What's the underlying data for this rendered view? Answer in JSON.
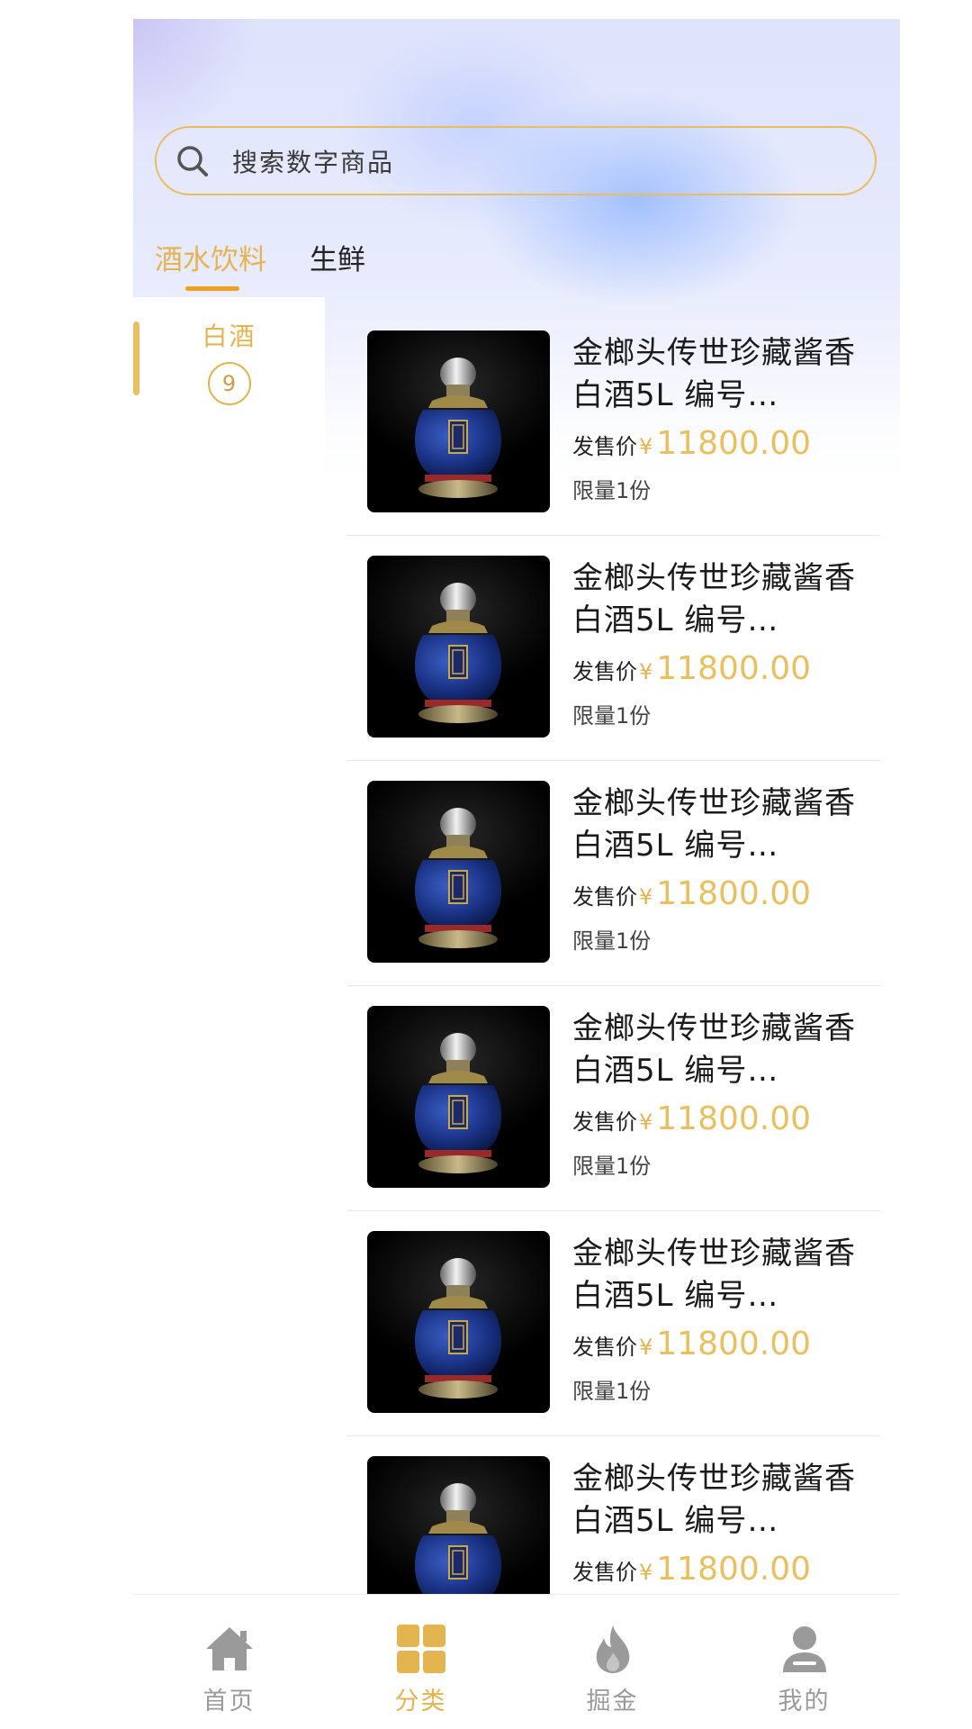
{
  "search": {
    "placeholder": "搜索数字商品",
    "icon": "search-icon"
  },
  "tabs": [
    {
      "label": "酒水饮料",
      "active": true
    },
    {
      "label": "生鲜",
      "active": false
    }
  ],
  "sidebar": {
    "items": [
      {
        "label": "白酒",
        "count": "9",
        "active": true
      }
    ]
  },
  "products": [
    {
      "title": "金榔头传世珍藏酱香白酒5L 编号…",
      "price_label": "发售价",
      "currency": "¥",
      "price": "11800.00",
      "limit": "限量1份"
    },
    {
      "title": "金榔头传世珍藏酱香白酒5L 编号…",
      "price_label": "发售价",
      "currency": "¥",
      "price": "11800.00",
      "limit": "限量1份"
    },
    {
      "title": "金榔头传世珍藏酱香白酒5L 编号…",
      "price_label": "发售价",
      "currency": "¥",
      "price": "11800.00",
      "limit": "限量1份"
    },
    {
      "title": "金榔头传世珍藏酱香白酒5L 编号…",
      "price_label": "发售价",
      "currency": "¥",
      "price": "11800.00",
      "limit": "限量1份"
    },
    {
      "title": "金榔头传世珍藏酱香白酒5L 编号…",
      "price_label": "发售价",
      "currency": "¥",
      "price": "11800.00",
      "limit": "限量1份"
    },
    {
      "title": "金榔头传世珍藏酱香白酒5L 编号…",
      "price_label": "发售价",
      "currency": "¥",
      "price": "11800.00",
      "limit": ""
    }
  ],
  "nav": [
    {
      "label": "首页",
      "icon": "home-icon",
      "active": false
    },
    {
      "label": "分类",
      "icon": "category-icon",
      "active": true
    },
    {
      "label": "掘金",
      "icon": "flame-icon",
      "active": false
    },
    {
      "label": "我的",
      "icon": "profile-icon",
      "active": false
    }
  ],
  "colors": {
    "accent": "#e3b44f",
    "price": "#e8c060",
    "tab_underline": "#f0a020",
    "inactive_nav": "#9a9a9a"
  }
}
